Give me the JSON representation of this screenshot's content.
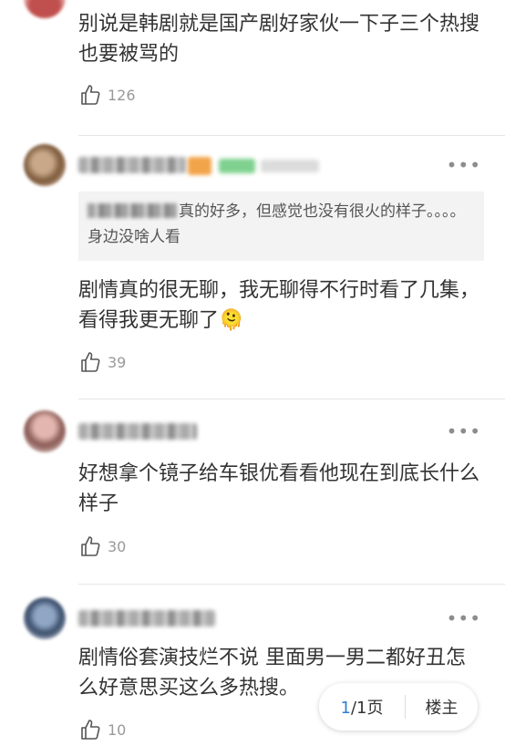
{
  "comments": [
    {
      "text": "别说是韩剧就是国产剧好家伙一下子三个热搜也要被骂的",
      "likes": "126"
    },
    {
      "quote_text": "真的好多，但感觉也没有很火的样子。。。。身边没啥人看",
      "text": "剧情真的很无聊，我无聊得不行时看了几集，看得我更无聊了🫠",
      "likes": "39"
    },
    {
      "text": "好想拿个镜子给车银优看看他现在到底长什么样子",
      "likes": "30"
    },
    {
      "text": "剧情俗套演技烂不说 里面男一男二都好丑怎么好意思买这么多热搜。",
      "likes": "10"
    }
  ],
  "pager": {
    "current": "1",
    "separator": "/1页",
    "floor_label": "楼主"
  },
  "icons": {
    "like": "thumbs-up-icon",
    "more": "more-dots-icon"
  },
  "colors": {
    "accent": "#2f7fd1",
    "text": "#333333",
    "muted": "#999999"
  }
}
